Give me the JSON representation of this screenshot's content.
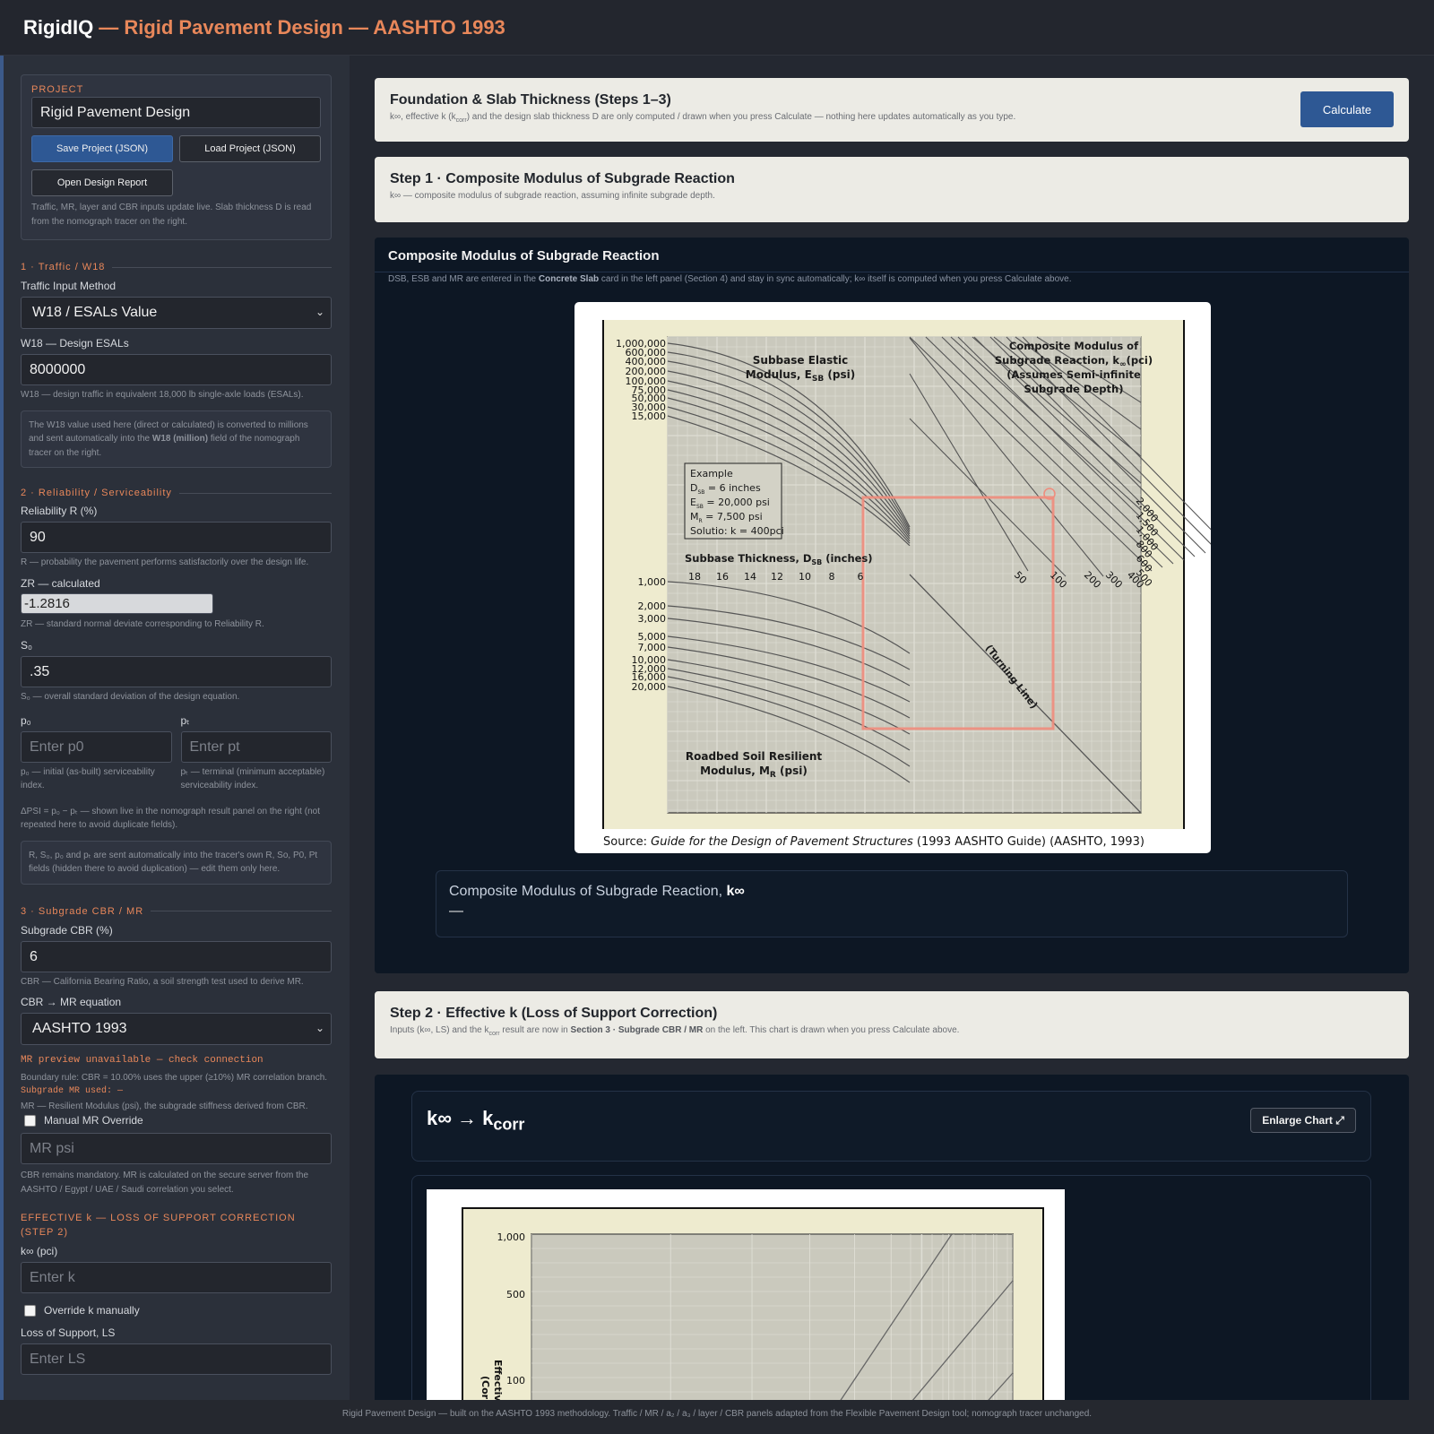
{
  "header": {
    "brand": "RigidIQ",
    "subtitle": "— Rigid Pavement Design — AASHTO 1993"
  },
  "sidebar": {
    "project": {
      "label": "PROJECT",
      "name": "Rigid Pavement Design",
      "save_label": "Save Project (JSON)",
      "load_label": "Load Project (JSON)",
      "report_label": "Open Design Report",
      "help": "Traffic, MR, layer and CBR inputs update live. Slab thickness D is read from the nomograph tracer on the right."
    },
    "traffic": {
      "title": "1 · Traffic / W18",
      "method_label": "Traffic Input Method",
      "method_value": "W18 / ESALs Value",
      "w18_label": "W18 — Design ESALs",
      "w18_value": "8000000",
      "w18_help": "W18 — design traffic in equivalent 18,000 lb single-axle loads (ESALs).",
      "note_a": "The W18 value used here (direct or calculated) is converted to millions and sent automatically into the ",
      "note_b": "W18 (million)",
      "note_c": " field of the nomograph tracer on the right."
    },
    "reliability": {
      "title": "2 · Reliability / Serviceability",
      "r_label": "Reliability R (%)",
      "r_value": "90",
      "r_help": "R — probability the pavement performs satisfactorily over the design life.",
      "zr_label": "ZR — calculated",
      "zr_value": "-1.2816",
      "zr_help": "ZR — standard normal deviate corresponding to Reliability R.",
      "so_label": "S₀",
      "so_value": ".35",
      "so_help": "S₀ — overall standard deviation of the design equation.",
      "p0_label": "p₀",
      "p0_placeholder": "Enter p0",
      "p0_help": "p₀ — initial (as-built) serviceability index.",
      "pt_label": "pₜ",
      "pt_placeholder": "Enter pt",
      "pt_help": "pₜ — terminal (minimum acceptable) serviceability index.",
      "dpsi_help": "ΔPSI = p₀ − pₜ — shown live in the nomograph result panel on the right (not repeated here to avoid duplicate fields).",
      "note": "R, S₀, p₀ and pₜ are sent automatically into the tracer's own R, So, P0, Pt fields (hidden there to avoid duplication) — edit them only here."
    },
    "subgrade": {
      "title": "3 · Subgrade CBR / MR",
      "cbr_label": "Subgrade CBR (%)",
      "cbr_value": "6",
      "cbr_help": "CBR — California Bearing Ratio, a soil strength test used to derive MR.",
      "eq_label": "CBR → MR equation",
      "eq_value": "AASHTO 1993",
      "preview": "MR preview unavailable — check connection",
      "boundary": "Boundary rule: CBR = 10.00% uses the upper (≥10%) MR correlation branch.",
      "mr_used": "Subgrade MR used: —",
      "mr_help": "MR — Resilient Modulus (psi), the subgrade stiffness derived from CBR.",
      "override_label": "Manual MR Override",
      "mr_placeholder": "MR psi",
      "server_help": "CBR remains mandatory. MR is calculated on the secure server from the AASHTO / Egypt / UAE / Saudi correlation you select."
    },
    "effk": {
      "title": "EFFECTIVE k — LOSS OF SUPPORT CORRECTION (STEP 2)",
      "k_label": "k∞ (pci)",
      "k_placeholder": "Enter k",
      "override_label": "Override k manually",
      "ls_label": "Loss of Support, LS",
      "ls_placeholder": "Enter LS"
    }
  },
  "main": {
    "foundation": {
      "title": "Foundation & Slab Thickness (Steps 1–3)",
      "desc_a": "k∞, effective k (k",
      "desc_sub": "corr",
      "desc_b": ") and the design slab thickness D are only computed / drawn when you press Calculate — nothing here updates automatically as you type.",
      "calc_label": "Calculate"
    },
    "step1": {
      "title": "Step 1 · Composite Modulus of Subgrade Reaction",
      "desc": "k∞ — composite modulus of subgrade reaction, assuming infinite subgrade depth."
    },
    "composite": {
      "title": "Composite Modulus of Subgrade Reaction",
      "desc_a": "DSB, ESB and MR are entered in the ",
      "desc_b": "Concrete Slab",
      "desc_c": " card in the left panel (Section 4) and stay in sync automatically; k∞ itself is computed when you press Calculate above.",
      "result_label": "Composite Modulus of Subgrade Reaction, ",
      "result_symbol": "k∞",
      "result_value": "—"
    },
    "nomograph": {
      "esb_labels": [
        "1,000,000",
        "600,000",
        "400,000",
        "200,000",
        "100,000",
        "75,000",
        "50,000",
        "30,000",
        "15,000"
      ],
      "mr_labels": [
        "1,000",
        "2,000",
        "3,000",
        "5,000",
        "7,000",
        "10,000",
        "12,000",
        "16,000",
        "20,000"
      ],
      "dsb_ticks": [
        "18",
        "16",
        "14",
        "12",
        "10",
        "8",
        "6"
      ],
      "k_ticks_low": [
        "50",
        "100",
        "200",
        "300",
        "400"
      ],
      "k_ticks_high": [
        "2,000",
        "1,500",
        "1,000",
        "800",
        "600",
        "500"
      ],
      "esb_title_1": "Subbase Elastic",
      "esb_title_2": "Modulus, E",
      "esb_title_sub": "SB",
      "esb_title_3": " (psi)",
      "k_title_1": "Composite Modulus of",
      "k_title_2": "Subgrade Reaction, k",
      "k_title_sub": "∞",
      "k_title_3": "(pci)",
      "k_title_4": "(Assumes Semi-infinite",
      "k_title_5": "Subgrade Depth)",
      "example_title": "Example",
      "example_lines": [
        "D",
        "E",
        "M",
        "Solutio: k = 400pci"
      ],
      "example_subs": [
        "SB",
        "SB",
        "R"
      ],
      "example_vals": [
        " = 6 inches",
        " = 20,000 psi",
        " = 7,500 psi"
      ],
      "dsb_title": "Subbase Thickness, D",
      "dsb_title_sub": "SB",
      "dsb_title_2": " (inches)",
      "turning": "(Turning Line)",
      "mr_title_1": "Roadbed Soil Resilient",
      "mr_title_2": "Modulus, M",
      "mr_title_sub": "R",
      "mr_title_3": " (psi)",
      "source_a": "Source: ",
      "source_b": "Guide for the Design of Pavement Structures",
      "source_c": " (1993 AASHTO Guide) (AASHTO, 1993)"
    },
    "step2": {
      "title": "Step 2 · Effective k (Loss of Support Correction)",
      "desc_a": "Inputs (k∞, LS) and the k",
      "desc_sub": "corr",
      "desc_b": " result are now in ",
      "desc_bold": "Section 3 · Subgrade CBR / MR",
      "desc_c": " on the left. This chart is drawn when you press Calculate above."
    },
    "kcorr": {
      "title_a": "k∞ → k",
      "title_sub": "corr",
      "enlarge_label": "Enlarge Chart ⤢",
      "y_ticks": [
        "1,000",
        "500",
        "100"
      ],
      "ylabel_1": "Effectiv",
      "ylabel_2": "(Corr"
    }
  },
  "footer": {
    "text": "Rigid Pavement Design — built on the AASHTO 1993 methodology. Traffic / MR / a₂ / a₃ / layer / CBR panels adapted from the Flexible Pavement Design tool; nomograph tracer unchanged."
  },
  "colors": {
    "accent": "#e8875a",
    "primary_button": "#2e5894",
    "trace": "#f08c7c"
  }
}
